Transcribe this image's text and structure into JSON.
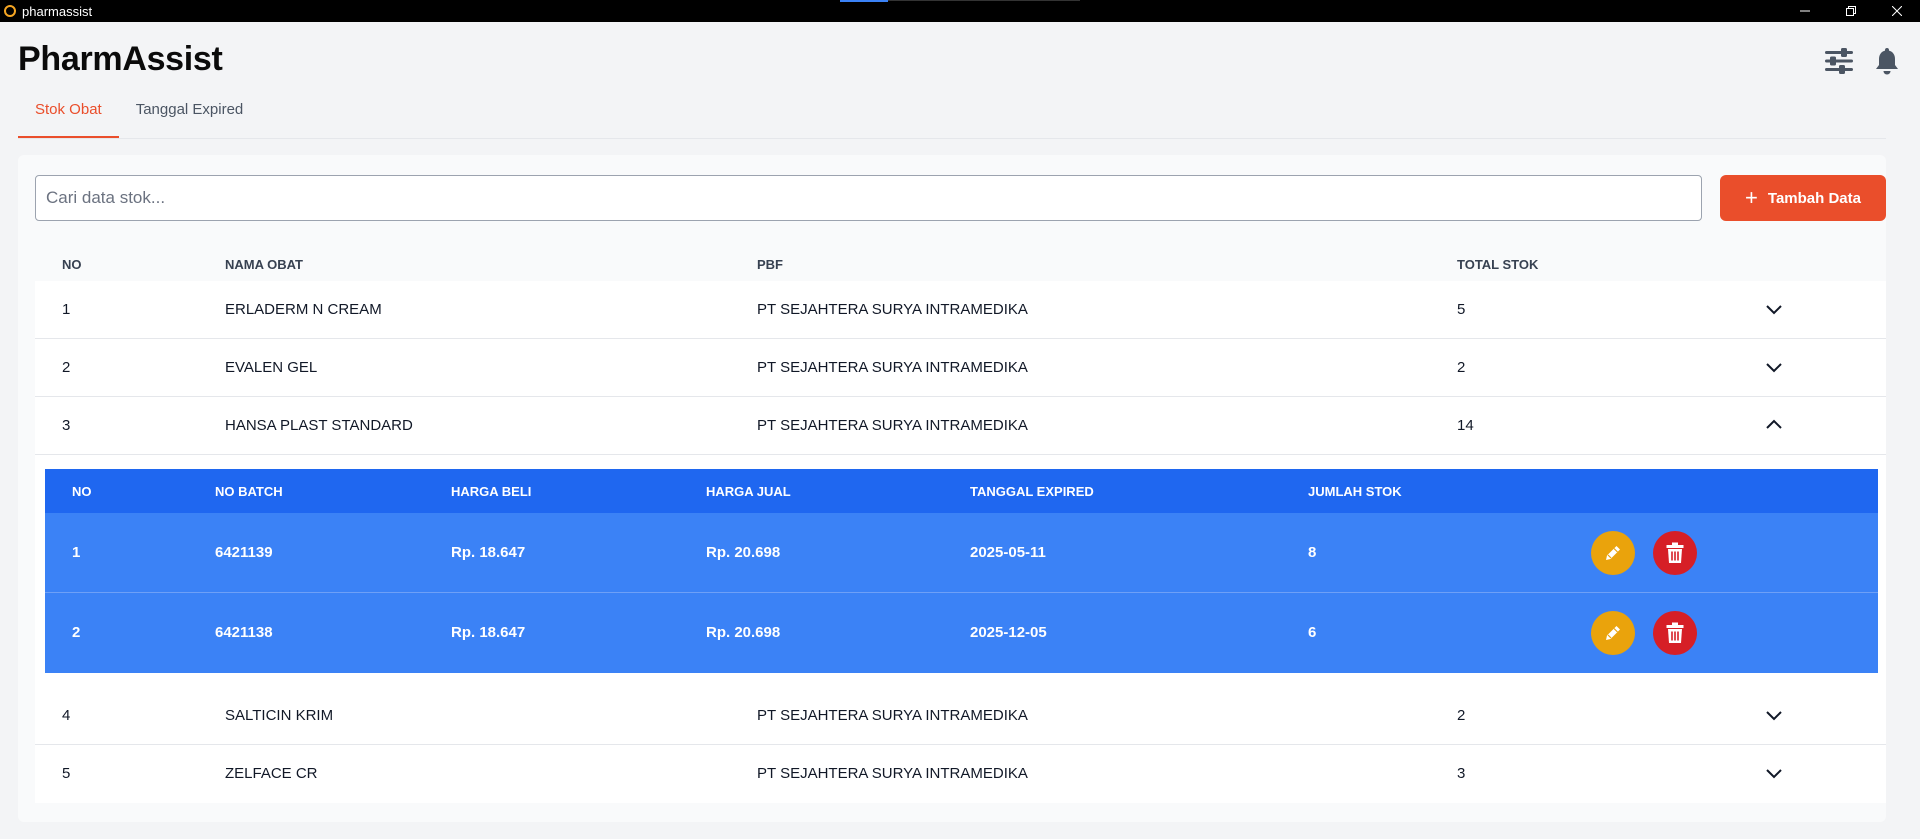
{
  "window": {
    "title": "pharmassist",
    "controls": [
      "minimize-icon",
      "restore-icon",
      "close-icon"
    ]
  },
  "header": {
    "title": "PharmAssist",
    "icons": [
      "filter-sliders-icon",
      "bell-icon"
    ]
  },
  "tabs": [
    {
      "label": "Stok Obat",
      "active": true
    },
    {
      "label": "Tanggal Expired",
      "active": false
    }
  ],
  "search": {
    "placeholder": "Cari data stok...",
    "value": ""
  },
  "add_button": {
    "label": "Tambah Data",
    "icon": "plus-icon"
  },
  "table": {
    "headers": {
      "no": "NO",
      "name": "NAMA OBAT",
      "pbf": "PBF",
      "total": "TOTAL STOK"
    },
    "rows": [
      {
        "no": "1",
        "name": "ERLADERM N CREAM",
        "pbf": "PT SEJAHTERA SURYA INTRAMEDIKA",
        "total": "5",
        "expanded": false
      },
      {
        "no": "2",
        "name": "EVALEN GEL",
        "pbf": "PT SEJAHTERA SURYA INTRAMEDIKA",
        "total": "2",
        "expanded": false
      },
      {
        "no": "3",
        "name": "HANSA PLAST STANDARD",
        "pbf": "PT SEJAHTERA SURYA INTRAMEDIKA",
        "total": "14",
        "expanded": true
      },
      {
        "no": "4",
        "name": "SALTICIN KRIM",
        "pbf": "PT SEJAHTERA SURYA INTRAMEDIKA",
        "total": "2",
        "expanded": false
      },
      {
        "no": "5",
        "name": "ZELFACE CR",
        "pbf": "PT SEJAHTERA SURYA INTRAMEDIKA",
        "total": "3",
        "expanded": false
      }
    ]
  },
  "detail": {
    "headers": {
      "no": "NO",
      "batch": "NO BATCH",
      "beli": "HARGA BELI",
      "jual": "HARGA JUAL",
      "exp": "TANGGAL EXPIRED",
      "stok": "JUMLAH STOK"
    },
    "rows": [
      {
        "no": "1",
        "batch": "6421139",
        "beli": "Rp. 18.647",
        "jual": "Rp. 20.698",
        "exp": "2025-05-11",
        "stok": "8"
      },
      {
        "no": "2",
        "batch": "6421138",
        "beli": "Rp. 18.647",
        "jual": "Rp. 20.698",
        "exp": "2025-12-05",
        "stok": "6"
      }
    ],
    "action_icons": [
      "pencil-icon",
      "trash-icon"
    ]
  },
  "colors": {
    "accent": "#ea4e2b",
    "detail_header": "#1f67f0",
    "detail_row": "#3b82f6",
    "edit": "#eaa30c",
    "delete": "#d61f26"
  }
}
